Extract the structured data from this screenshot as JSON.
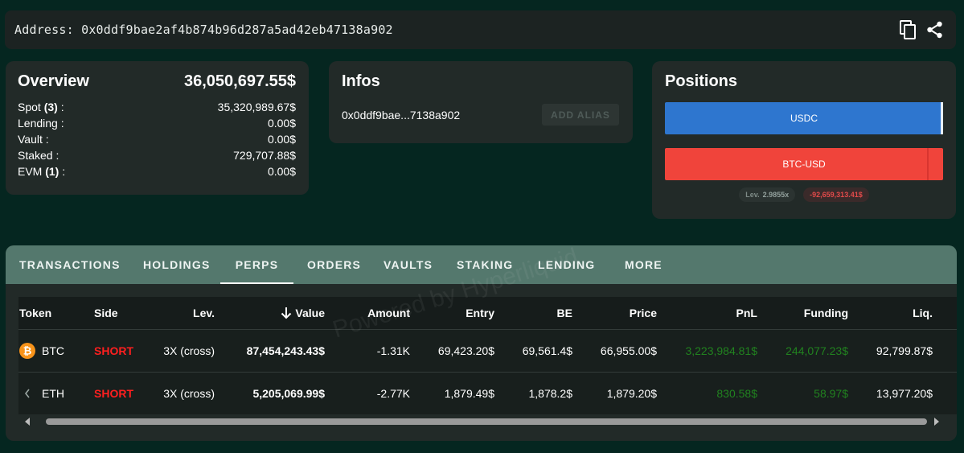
{
  "address_bar": {
    "label": "Address:",
    "address": "0x0ddf9bae2af4b874b96d287a5ad42eb47138a902"
  },
  "overview": {
    "title": "Overview",
    "total": "36,050,697.55$",
    "rows": [
      {
        "label": "Spot",
        "count": "(3)",
        "suffix": " :",
        "value": "35,320,989.67$"
      },
      {
        "label": "Lending :",
        "count": "",
        "suffix": "",
        "value": "0.00$"
      },
      {
        "label": "Vault :",
        "count": "",
        "suffix": "",
        "value": "0.00$"
      },
      {
        "label": "Staked :",
        "count": "",
        "suffix": "",
        "value": "729,707.88$"
      },
      {
        "label": "EVM",
        "count": "(1)",
        "suffix": " :",
        "value": "0.00$"
      }
    ]
  },
  "infos": {
    "title": "Infos",
    "short_address": "0x0ddf9bae...7138a902",
    "alias_button": "ADD ALIAS"
  },
  "positions": {
    "title": "Positions",
    "bars": [
      {
        "label": "USDC",
        "color": "#2e76cf"
      },
      {
        "label": "BTC-USD",
        "color": "#f0443b"
      }
    ],
    "leverage_label": "Lev.",
    "leverage_value": "2.9855x",
    "pnl": "-92,659,313.41$"
  },
  "tabs": [
    {
      "label": "TRANSACTIONS",
      "active": false
    },
    {
      "label": "HOLDINGS",
      "active": false
    },
    {
      "label": "PERPS",
      "active": true
    },
    {
      "label": "ORDERS",
      "active": false
    },
    {
      "label": "VAULTS",
      "active": false
    },
    {
      "label": "STAKING",
      "active": false
    },
    {
      "label": "LENDING",
      "active": false
    },
    {
      "label": "MORE",
      "active": false
    }
  ],
  "table": {
    "headers": [
      "Token",
      "Side",
      "Lev.",
      "Value",
      "Amount",
      "Entry",
      "BE",
      "Price",
      "PnL",
      "Funding",
      "Liq."
    ],
    "sort_icon": "arrow-down-icon",
    "rows": [
      {
        "token": "BTC",
        "icon": "bitcoin-icon",
        "side": "SHORT",
        "lev": "3X (cross)",
        "value": "87,454,243.43$",
        "amount": "-1.31K",
        "entry": "69,423.20$",
        "be": "69,561.4$",
        "price": "66,955.00$",
        "pnl": "3,223,984.81$",
        "funding": "244,077.23$",
        "liq": "92,799.87$"
      },
      {
        "token": "ETH",
        "icon": "ethereum-icon",
        "side": "SHORT",
        "lev": "3X (cross)",
        "value": "5,205,069.99$",
        "amount": "-2.77K",
        "entry": "1,879.49$",
        "be": "1,878.2$",
        "price": "1,879.20$",
        "pnl": "830.58$",
        "funding": "58.97$",
        "liq": "13,977.20$"
      }
    ]
  },
  "watermark": "Powered by Hyperliquid",
  "colors": {
    "background": "#052620",
    "card": "#222a28",
    "tab_bar": "#54786d",
    "short": "#ff1f1f",
    "positive": "#21821f"
  }
}
